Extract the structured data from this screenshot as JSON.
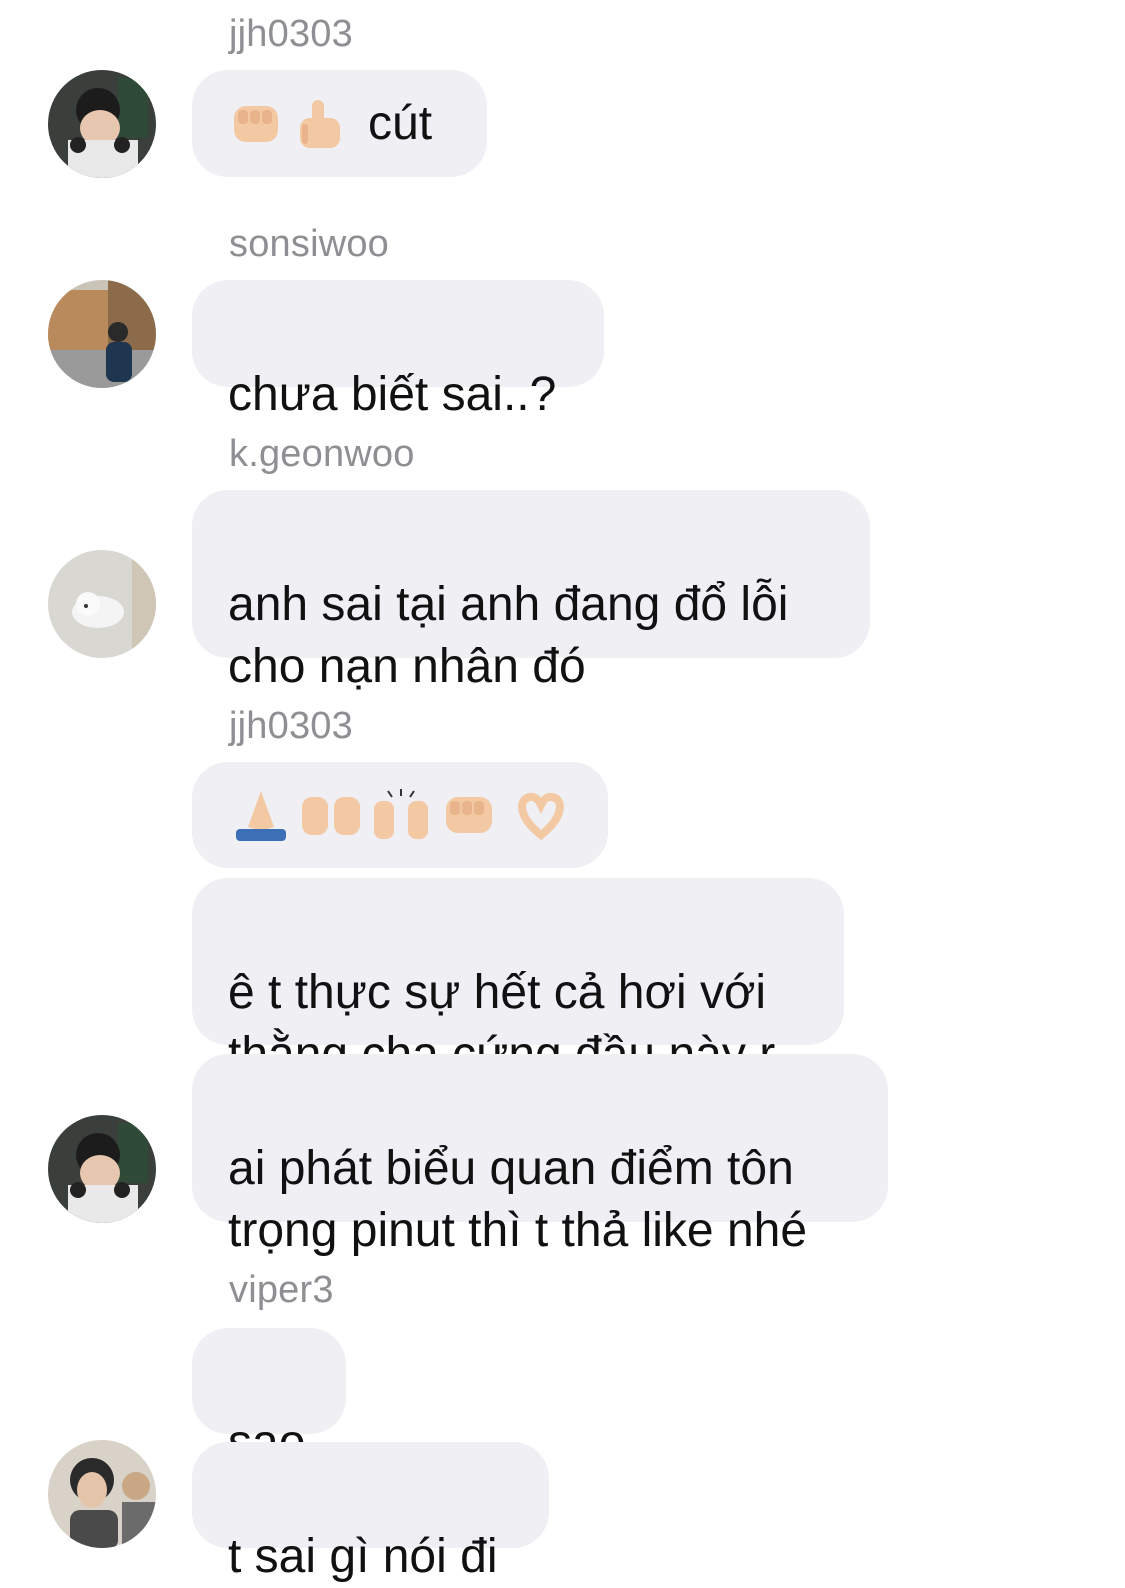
{
  "messages": [
    {
      "sender": "jjh0303",
      "text": "cút",
      "emojis": [
        "fist-icon",
        "thumbs-up-icon"
      ]
    },
    {
      "sender": "sonsiwoo",
      "text": "chưa biết sai..?"
    },
    {
      "sender": "k.geonwoo",
      "text": "anh sai tại anh đang đổ lỗi\ncho nạn nhân đó"
    },
    {
      "sender": "jjh0303",
      "emojis": [
        "folded-hands-icon",
        "palms-up-icon",
        "raised-hands-icon",
        "fist-icon",
        "heart-hands-icon"
      ]
    },
    {
      "text": "ê t thực sự hết cả hơi với\nthằng cha cứng đầu này r"
    },
    {
      "text": "ai phát biểu quan điểm tôn\ntrọng pinut thì t thả like nhé"
    },
    {
      "sender": "viper3",
      "text": "sao"
    },
    {
      "text": "t sai gì nói đi"
    }
  ],
  "colors": {
    "bubble": "#efeff4",
    "sender_name": "#8e8e93",
    "text": "#111111",
    "skin": "#f3c9a4"
  }
}
